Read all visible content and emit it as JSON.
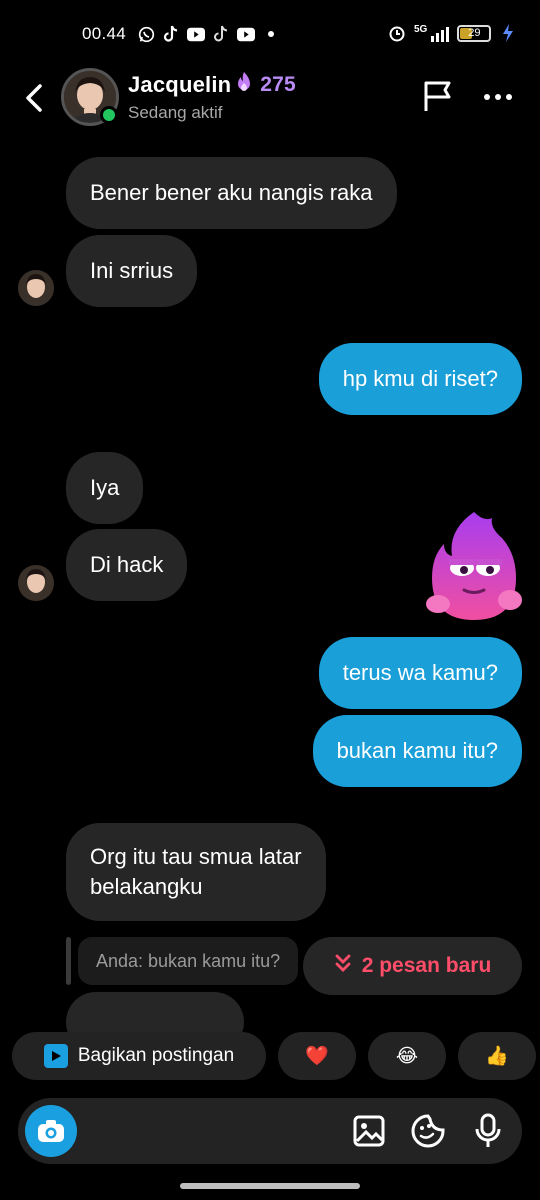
{
  "status_bar": {
    "time": "00.44",
    "network": "5G",
    "battery": "29",
    "icons": [
      "whatsapp-icon",
      "tiktok-icon",
      "youtube-icon",
      "tiktok-icon",
      "youtube-icon",
      "dot-icon",
      "alarm-icon",
      "signal-icon",
      "battery-icon",
      "charging-icon"
    ]
  },
  "header": {
    "name": "Jacquelin",
    "streak": "275",
    "status": "Sedang aktif"
  },
  "messages": [
    {
      "from": "them",
      "text": "Bener bener aku nangis raka"
    },
    {
      "from": "them",
      "text": "Ini srrius"
    },
    {
      "from": "me",
      "text": "hp kmu di riset?"
    },
    {
      "from": "them",
      "text": "Iya"
    },
    {
      "from": "them",
      "text": "Di hack"
    },
    {
      "from": "me",
      "text": "terus wa kamu?"
    },
    {
      "from": "me",
      "text": "bukan kamu itu?"
    },
    {
      "from": "them",
      "text_line1": "Org itu tau smua latar",
      "text_line2": "belakangku"
    }
  ],
  "reply_quote": "Anda: bukan kamu itu?",
  "new_messages": "2 pesan baru",
  "quick_replies": {
    "share": "Bagikan postingan",
    "emojis": [
      "❤️",
      "😂",
      "👍"
    ]
  },
  "colors": {
    "sent_bubble": "#1a9fd9",
    "received_bubble": "#262626",
    "accent_streak": "#b98cf5",
    "new_message": "#ff4d6a",
    "online": "#23c55e"
  }
}
